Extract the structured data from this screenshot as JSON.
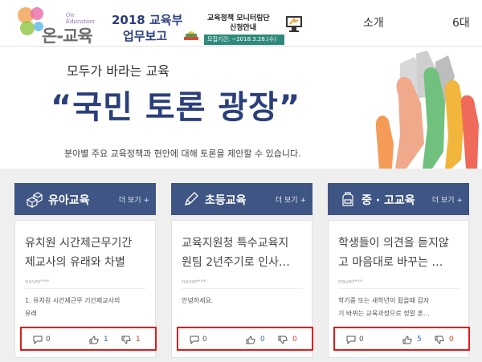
{
  "header": {
    "logo": {
      "tagline": "On Education",
      "name": "온-교육"
    },
    "banner_report": {
      "line1": "2018 교육부",
      "line2": "업무보고"
    },
    "banner_monitoring": {
      "line1": "교육정책 모니터링단",
      "line2": "신청안내",
      "period": "모집기간: ~2018.3.28.(수)"
    },
    "nav": [
      "소개",
      "6대"
    ]
  },
  "hero": {
    "eyebrow": "모두가 바라는 교육",
    "title": "“국민 토론 광장”",
    "description": "분야별 주요 교육정책과 현안에 대해 토론을 제안할 수 있습니다."
  },
  "sections": [
    {
      "icon": "blocks-icon",
      "title": "유아교육",
      "more": "더 보기 +",
      "card": {
        "title_line1": "유치원 시간제근무기간",
        "title_line2": "제교사의 유래와 차별",
        "author": "naver***",
        "excerpt_line1": "1. 유치원 시간제근무 기간제교사의",
        "excerpt_line2": "유래",
        "comments": "0",
        "likes": "1",
        "dislikes": "1"
      }
    },
    {
      "icon": "pencil-icon",
      "title": "초등교육",
      "more": "더 보기 +",
      "card": {
        "title_line1": "교육지원청 특수교육지",
        "title_line2": "원팀 2년주기로 인사…",
        "author": "naver***",
        "excerpt_line1": "안녕하세요.",
        "excerpt_line2": "",
        "comments": "0",
        "likes": "0",
        "dislikes": "0"
      }
    },
    {
      "icon": "backpack-icon",
      "title": "중 · 고교육",
      "more": "더 보기 +",
      "card": {
        "title_line1": "학생들이 의견을 듣지않",
        "title_line2": "고 마음대로 바꾸는 …",
        "author": "naver***",
        "excerpt_line1": "학기중 또는 새학년이 됬을때 갑자",
        "excerpt_line2": "기 바뀌는 교육과정으로 정말 혼…",
        "comments": "0",
        "likes": "5",
        "dislikes": "0"
      }
    }
  ],
  "colors": {
    "accent_navy": "#3f5583",
    "title_navy": "#2b3f7a",
    "highlight_red": "#e41b1b",
    "like_blue": "#3b67c9",
    "dislike_red": "#d9412c"
  }
}
